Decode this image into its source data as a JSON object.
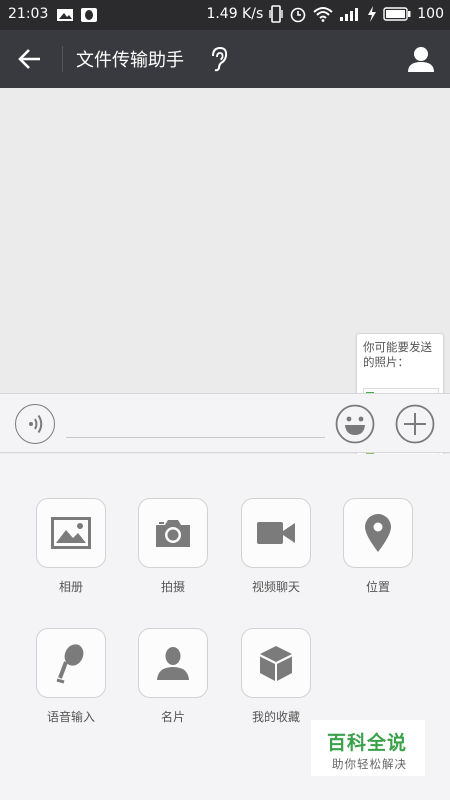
{
  "status_bar": {
    "time": "21:03",
    "net_speed": "1.49 K/s",
    "battery": "100"
  },
  "header": {
    "title": "文件传输助手",
    "icons": [
      "back-arrow-icon",
      "ear-icon",
      "profile-icon"
    ]
  },
  "chat": {
    "photo_suggestion": {
      "text": "你可能要发送的照片："
    }
  },
  "input_bar": {
    "icons": [
      "voice-icon",
      "emoji-icon",
      "plus-icon"
    ]
  },
  "panel": {
    "items": [
      {
        "label": "相册",
        "icon": "album-icon"
      },
      {
        "label": "拍摄",
        "icon": "camera-icon"
      },
      {
        "label": "视频聊天",
        "icon": "video-call-icon"
      },
      {
        "label": "位置",
        "icon": "location-icon"
      },
      {
        "label": "语音输入",
        "icon": "microphone-icon"
      },
      {
        "label": "名片",
        "icon": "contact-card-icon"
      },
      {
        "label": "我的收藏",
        "icon": "favorites-box-icon"
      }
    ]
  },
  "watermark": {
    "title": "百科全说",
    "subtitle": "助你轻松解决"
  },
  "colors": {
    "title_bar": "#393a3f",
    "status_bar": "#2b2b2d",
    "chat_bg": "#ebebeb",
    "panel_bg": "#f4f4f6",
    "icon_gray": "#7b7b7b",
    "watermark_green": "#3aa14a"
  }
}
